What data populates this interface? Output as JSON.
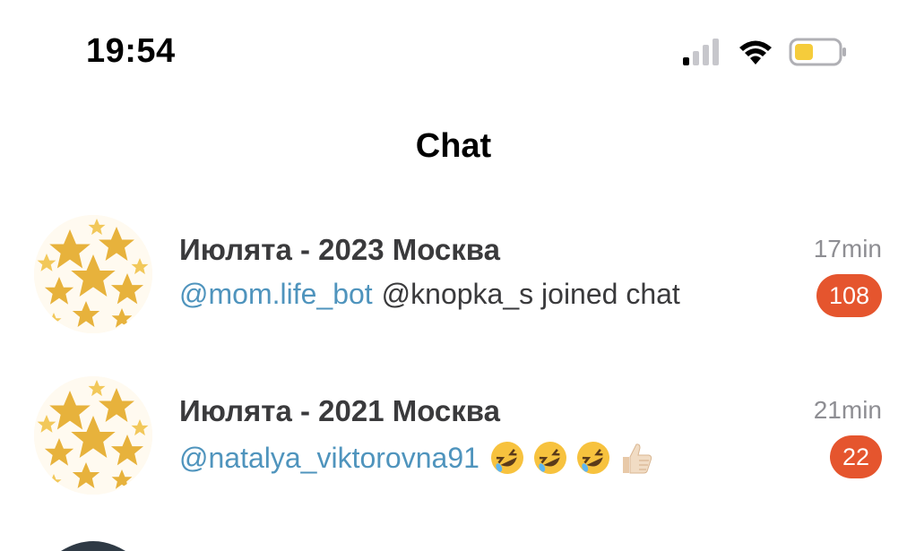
{
  "status_bar": {
    "time": "19:54"
  },
  "header": {
    "title": "Chat"
  },
  "chats": [
    {
      "name": "Июлята - 2023 Москва",
      "preview_mention": "@mom.life_bot",
      "preview_text": "@knopka_s joined chat",
      "time": "17min",
      "unread": "108"
    },
    {
      "name": "Июлята - 2021 Москва",
      "preview_mention": "@natalya_viktorovna91",
      "preview_emojis": [
        "rofl-emoji",
        "rofl-emoji",
        "rofl-emoji",
        "thumbs-up-emoji"
      ],
      "time": "21min",
      "unread": "22"
    }
  ],
  "colors": {
    "accent_mention": "#4f94bd",
    "badge": "#e5552e",
    "battery": "#f5cc3b"
  }
}
